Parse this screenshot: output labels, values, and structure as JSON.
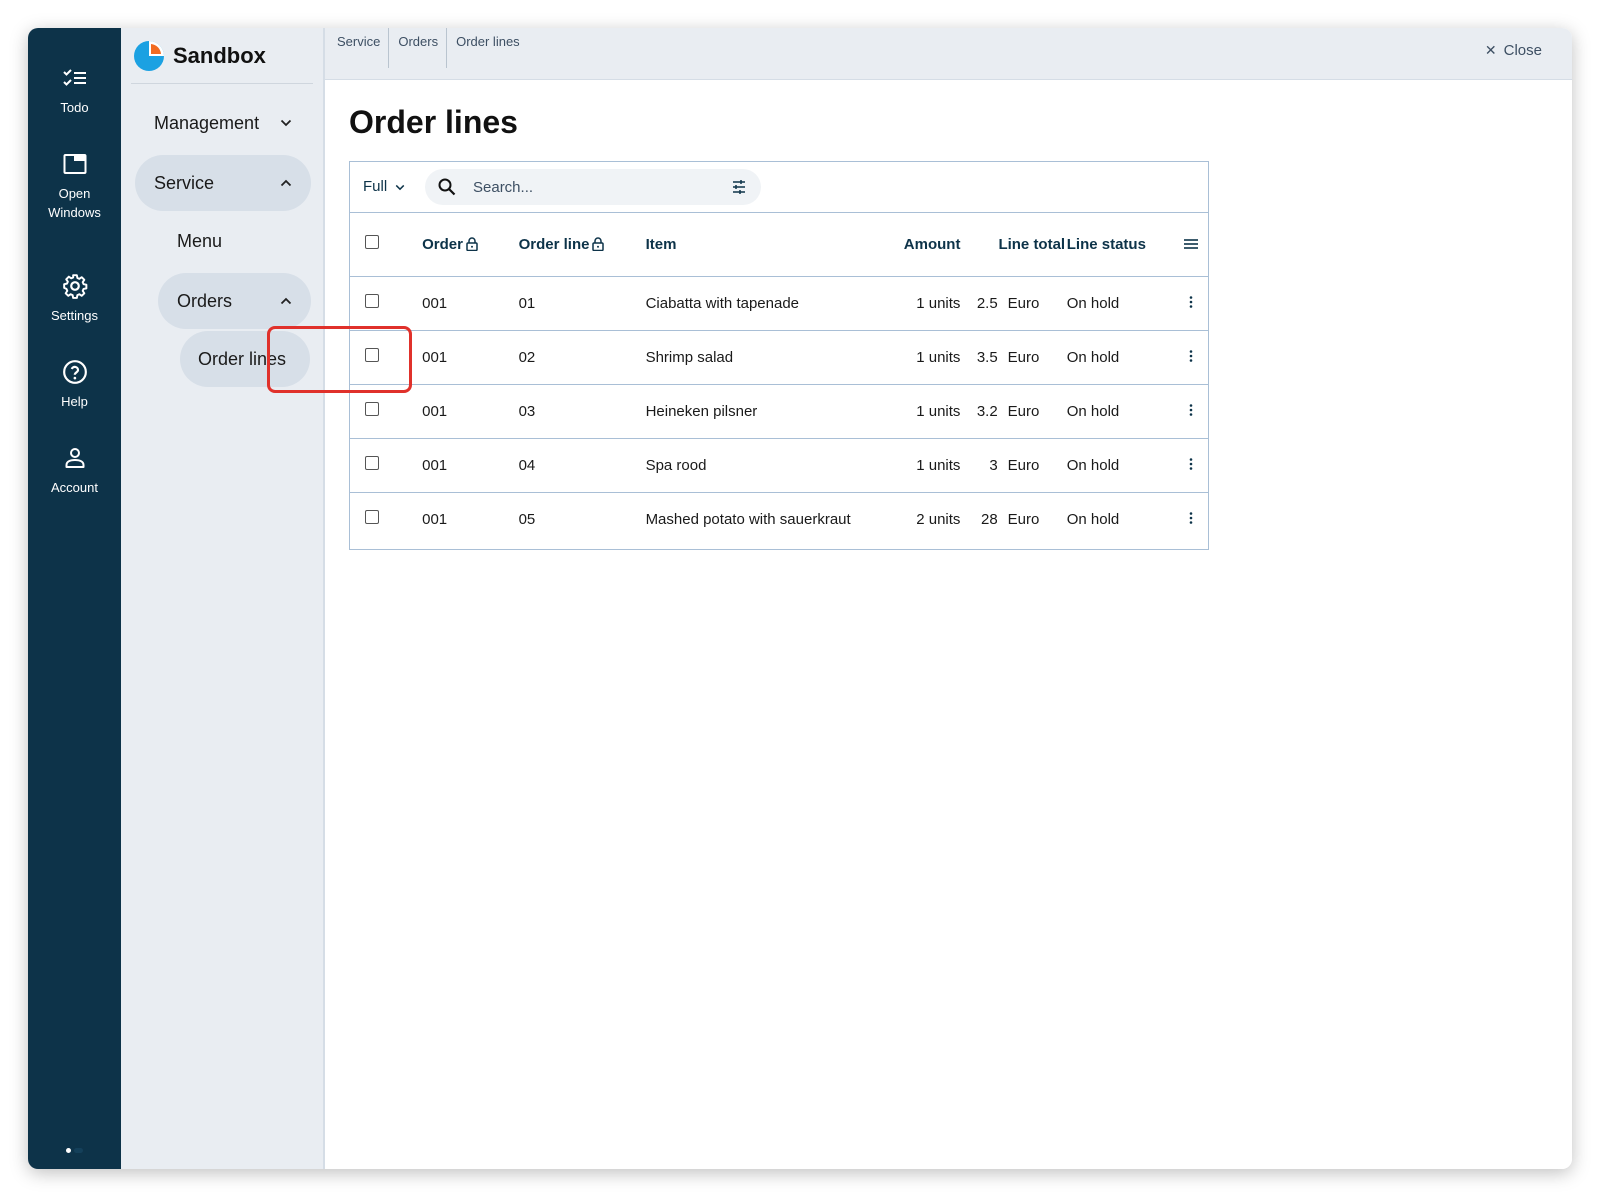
{
  "rail": {
    "items": [
      {
        "label": "Todo",
        "icon": "todo-checklist-icon"
      },
      {
        "label": "Open Windows",
        "icon": "open-windows-icon"
      },
      {
        "label": "Settings",
        "icon": "gear-icon"
      },
      {
        "label": "Help",
        "icon": "help-circle-icon"
      },
      {
        "label": "Account",
        "icon": "account-person-icon"
      }
    ]
  },
  "brand": {
    "name": "Sandbox"
  },
  "nav": {
    "management": "Management",
    "service": "Service",
    "menu": "Menu",
    "orders": "Orders",
    "order_lines": "Order lines"
  },
  "breadcrumb": [
    "Service",
    "Orders",
    "Order lines"
  ],
  "close_label": "Close",
  "page_title": "Order lines",
  "toolbar": {
    "view": "Full",
    "search_placeholder": "Search..."
  },
  "table": {
    "headers": {
      "order": "Order",
      "order_line": "Order line",
      "item": "Item",
      "amount": "Amount",
      "line_total": "Line total",
      "line_status": "Line status"
    },
    "rows": [
      {
        "order": "001",
        "line": "01",
        "item": "Ciabatta with tapenade",
        "amount": "1 units",
        "total": "2.5",
        "currency": "Euro",
        "status": "On hold"
      },
      {
        "order": "001",
        "line": "02",
        "item": "Shrimp salad",
        "amount": "1 units",
        "total": "3.5",
        "currency": "Euro",
        "status": "On hold"
      },
      {
        "order": "001",
        "line": "03",
        "item": "Heineken pilsner",
        "amount": "1 units",
        "total": "3.2",
        "currency": "Euro",
        "status": "On hold"
      },
      {
        "order": "001",
        "line": "04",
        "item": "Spa rood",
        "amount": "1 units",
        "total": "3",
        "currency": "Euro",
        "status": "On hold"
      },
      {
        "order": "001",
        "line": "05",
        "item": "Mashed potato with sauerkraut",
        "amount": "2 units",
        "total": "28",
        "currency": "Euro",
        "status": "On hold"
      }
    ]
  },
  "colors": {
    "rail_bg": "#0d3349",
    "nav_bg": "#e9edf2",
    "header_text": "#0d3349",
    "highlight": "#e0312b",
    "logo_blue": "#1ba1e2",
    "logo_orange": "#f26b21"
  }
}
